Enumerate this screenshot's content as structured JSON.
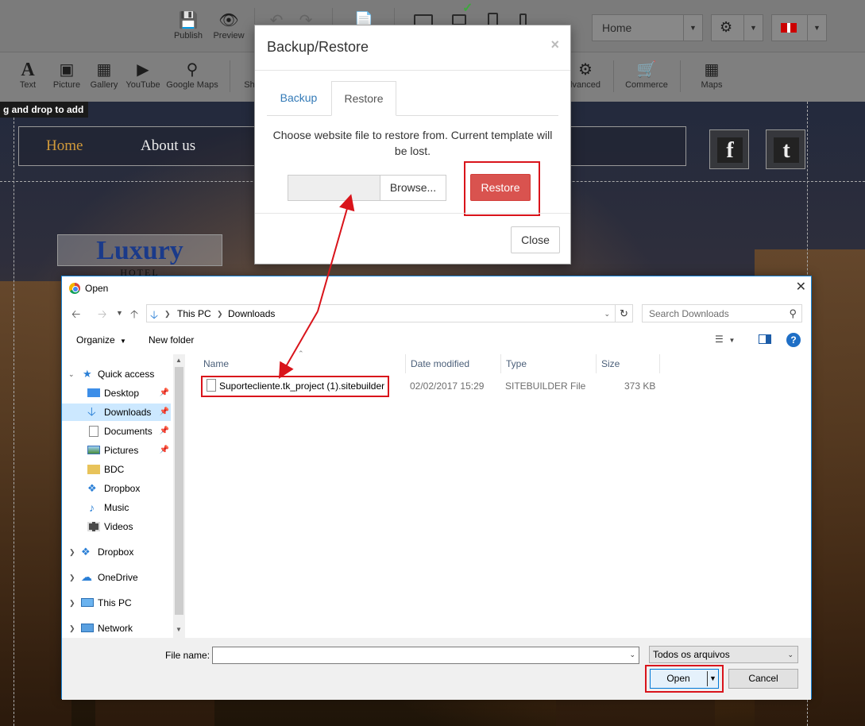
{
  "toolbar_top": {
    "publish": "Publish",
    "preview": "Preview",
    "page_select": "Home"
  },
  "toolbar_widgets": {
    "text": "Text",
    "picture": "Picture",
    "gallery": "Gallery",
    "youtube": "YouTube",
    "google_maps": "Google Maps",
    "shapes_partial": "Sh",
    "advanced_partial": "lvanced",
    "commerce": "Commerce",
    "maps": "Maps"
  },
  "drag_hint": "g and drop to add",
  "site": {
    "nav_home": "Home",
    "nav_about": "About us",
    "logo_title": "Luxury",
    "logo_sub": "HOTEL",
    "facebook_glyph": "f",
    "twitter_glyph": "t"
  },
  "modal": {
    "title": "Backup/Restore",
    "close_x": "×",
    "tab_backup": "Backup",
    "tab_restore": "Restore",
    "instructions": "Choose website file to restore from. Current template will be lost.",
    "browse": "Browse...",
    "restore": "Restore",
    "close": "Close"
  },
  "dialog": {
    "title": "Open",
    "close_x": "✕",
    "breadcrumb": [
      "This PC",
      "Downloads"
    ],
    "search_placeholder": "Search Downloads",
    "organize": "Organize",
    "new_folder": "New folder",
    "nav_items": [
      {
        "label": "Quick access",
        "icon": "star-icon"
      },
      {
        "label": "Desktop",
        "icon": "desktop-icon"
      },
      {
        "label": "Downloads",
        "icon": "download-arrow-icon"
      },
      {
        "label": "Documents",
        "icon": "documents-icon"
      },
      {
        "label": "Pictures",
        "icon": "pictures-icon"
      },
      {
        "label": "BDC",
        "icon": "folder-icon"
      },
      {
        "label": "Dropbox",
        "icon": "dropbox-icon"
      },
      {
        "label": "Music",
        "icon": "music-icon"
      },
      {
        "label": "Videos",
        "icon": "videos-icon"
      },
      {
        "label": "Dropbox",
        "icon": "dropbox-icon"
      },
      {
        "label": "OneDrive",
        "icon": "onedrive-icon"
      },
      {
        "label": "This PC",
        "icon": "computer-icon"
      },
      {
        "label": "Network",
        "icon": "network-icon"
      }
    ],
    "columns": [
      "Name",
      "Date modified",
      "Type",
      "Size"
    ],
    "files": [
      {
        "name": "Suportecliente.tk_project (1).sitebuilder",
        "date": "02/02/2017 15:29",
        "type": "SITEBUILDER File",
        "size": "373 KB"
      }
    ],
    "file_name_label": "File name:",
    "file_name_value": "",
    "file_type": "Todos os arquivos",
    "open": "Open",
    "cancel": "Cancel"
  },
  "colors": {
    "highlight_red": "#d9141b",
    "restore_button": "#d9534f",
    "link_blue": "#337ab7",
    "selection": "#cce8ff"
  }
}
